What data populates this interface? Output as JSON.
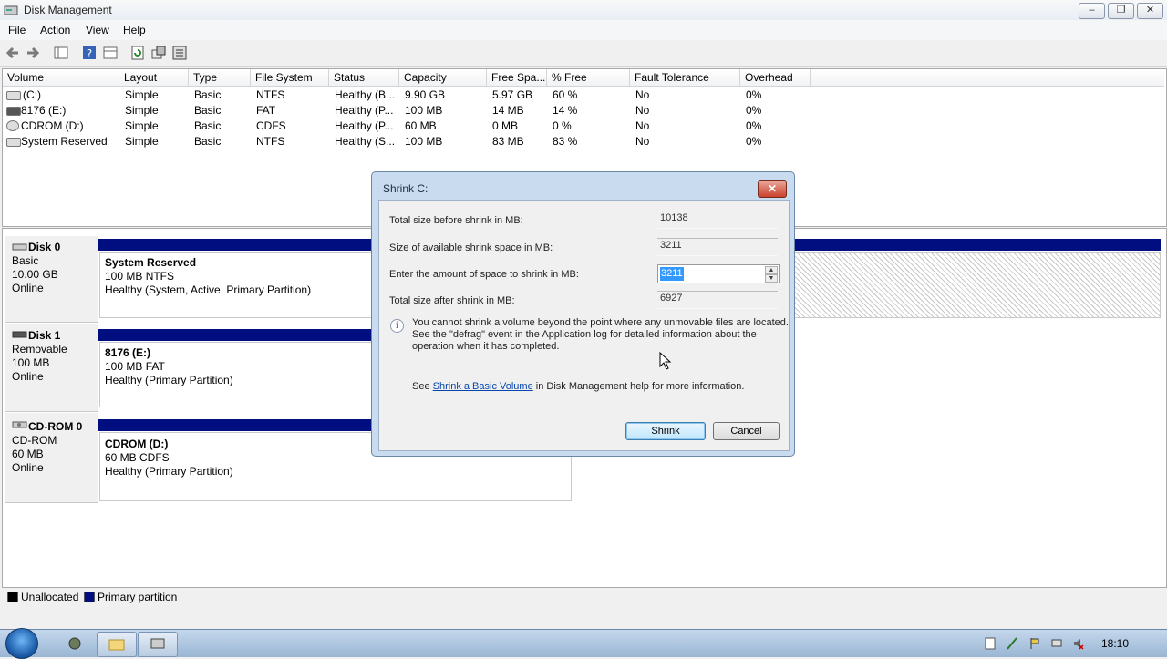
{
  "window": {
    "title": "Disk Management",
    "min": "–",
    "max": "❐",
    "close": "✕"
  },
  "menu": [
    {
      "label": "File"
    },
    {
      "label": "Action"
    },
    {
      "label": "View"
    },
    {
      "label": "Help"
    }
  ],
  "columns": [
    "Volume",
    "Layout",
    "Type",
    "File System",
    "Status",
    "Capacity",
    "Free Spa...",
    "% Free",
    "Fault Tolerance",
    "Overhead"
  ],
  "volumes": [
    {
      "volume": "(C:)",
      "layout": "Simple",
      "type": "Basic",
      "fs": "NTFS",
      "status": "Healthy (B...",
      "capacity": "9.90 GB",
      "free": "5.97 GB",
      "pct": "60 %",
      "fault": "No",
      "overhead": "0%"
    },
    {
      "volume": "8176 (E:)",
      "layout": "Simple",
      "type": "Basic",
      "fs": "FAT",
      "status": "Healthy (P...",
      "capacity": "100 MB",
      "free": "14 MB",
      "pct": "14 %",
      "fault": "No",
      "overhead": "0%"
    },
    {
      "volume": "CDROM (D:)",
      "layout": "Simple",
      "type": "Basic",
      "fs": "CDFS",
      "status": "Healthy (P...",
      "capacity": "60 MB",
      "free": "0 MB",
      "pct": "0 %",
      "fault": "No",
      "overhead": "0%"
    },
    {
      "volume": "System Reserved",
      "layout": "Simple",
      "type": "Basic",
      "fs": "NTFS",
      "status": "Healthy (S...",
      "capacity": "100 MB",
      "free": "83 MB",
      "pct": "83 %",
      "fault": "No",
      "overhead": "0%"
    }
  ],
  "disks": [
    {
      "name": "Disk 0",
      "type": "Basic",
      "size": "10.00 GB",
      "state": "Online",
      "partition": {
        "name": "System Reserved",
        "size": "100 MB NTFS",
        "status": "Healthy (System, Active, Primary Partition)"
      }
    },
    {
      "name": "Disk 1",
      "type": "Removable",
      "size": "100 MB",
      "state": "Online",
      "partition": {
        "name": "8176  (E:)",
        "size": "100 MB FAT",
        "status": "Healthy (Primary Partition)"
      }
    },
    {
      "name": "CD-ROM 0",
      "type": "CD-ROM",
      "size": "60 MB",
      "state": "Online",
      "partition": {
        "name": "CDROM  (D:)",
        "size": "60 MB CDFS",
        "status": "Healthy (Primary Partition)"
      }
    }
  ],
  "legend": {
    "unallocated": "Unallocated",
    "primary": "Primary partition",
    "unallocated_color": "#000000",
    "primary_color": "#000e80"
  },
  "dialog": {
    "title": "Shrink C:",
    "close": "✕",
    "label_total_before": "Total size before shrink in MB:",
    "total_before": "10138",
    "label_available": "Size of available shrink space in MB:",
    "available": "3211",
    "label_enter": "Enter the amount of space to shrink in MB:",
    "enter_value": "3211",
    "label_total_after": "Total size after shrink in MB:",
    "total_after": "6927",
    "info_line1": "You cannot shrink a volume beyond the point where any unmovable files are located.",
    "info_line2": "See the \"defrag\" event in the Application log for detailed information about the",
    "info_line3": "operation when it has completed.",
    "see_prefix": "See",
    "see_link": "Shrink a Basic Volume",
    "see_suffix": "in Disk Management help for more information.",
    "shrink_button": "Shrink",
    "cancel_button": "Cancel"
  },
  "taskbar": {
    "clock": "18:10"
  }
}
